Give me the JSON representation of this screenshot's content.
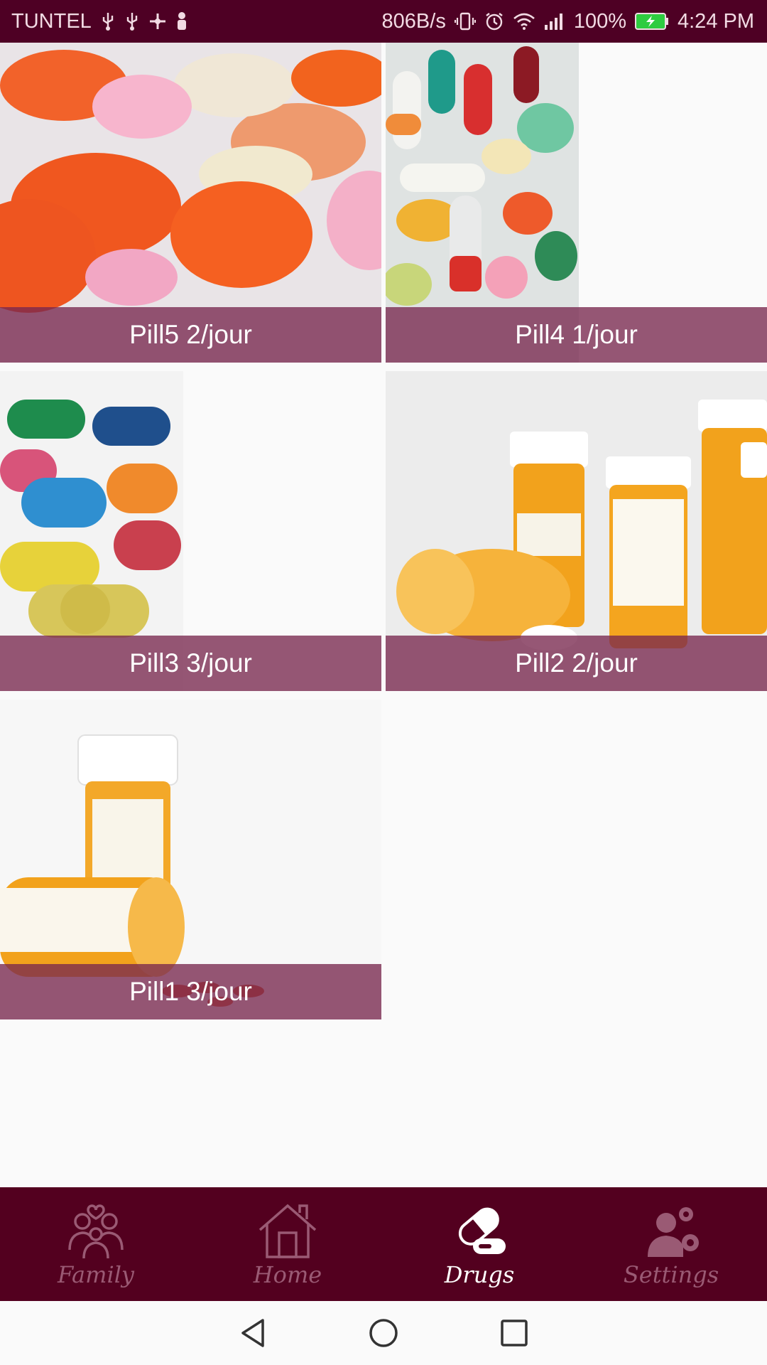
{
  "status_bar": {
    "carrier": "TUNTEL",
    "net_speed": "806B/s",
    "battery": "100%",
    "time": "4:24 PM",
    "icons": [
      "usb-icon",
      "usb-icon",
      "sync-icon",
      "person-icon",
      "vibrate-icon",
      "alarm-icon",
      "wifi-icon",
      "signal-icon",
      "battery-charging-icon"
    ]
  },
  "drugs": [
    {
      "label": "Pill5 2/jour",
      "image": "orange-pink-tablets"
    },
    {
      "label": "Pill4 1/jour",
      "image": "assorted-capsules"
    },
    {
      "label": "Pill3 3/jour",
      "image": "bead-capsules"
    },
    {
      "label": "Pill2 2/jour",
      "image": "pharmacy-bottles"
    },
    {
      "label": "Pill1 3/jour",
      "image": "spilled-pill-bottle"
    }
  ],
  "bottom_nav": {
    "items": [
      {
        "label": "Family",
        "icon": "family-icon",
        "active": false
      },
      {
        "label": "Home",
        "icon": "home-icon",
        "active": false
      },
      {
        "label": "Drugs",
        "icon": "pill-icon",
        "active": true
      },
      {
        "label": "Settings",
        "icon": "settings-user-icon",
        "active": false
      }
    ]
  },
  "colors": {
    "status_bar_bg": "#4e0024",
    "bottom_nav_bg": "#53001f",
    "caption_bg": "#78284e",
    "nav_inactive": "#9a5a74",
    "nav_active": "#ffffff"
  }
}
